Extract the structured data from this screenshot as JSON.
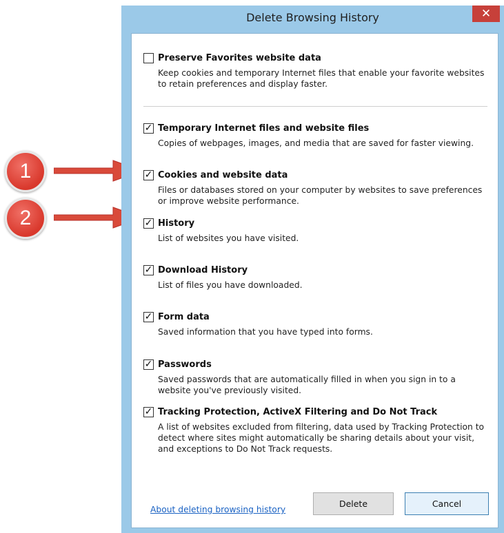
{
  "window": {
    "title": "Delete Browsing History",
    "close_glyph": "✕"
  },
  "items": [
    {
      "label": "Preserve Favorites website data",
      "checked": false,
      "description": "Keep cookies and temporary Internet files that enable your favorite websites to retain preferences and display faster."
    },
    {
      "label": "Temporary Internet files and website files",
      "checked": true,
      "description": "Copies of webpages, images, and media that are saved for faster viewing."
    },
    {
      "label": "Cookies and website data",
      "checked": true,
      "description": "Files or databases stored on your computer by websites to save preferences or improve website performance."
    },
    {
      "label": "History",
      "checked": true,
      "description": "List of websites you have visited."
    },
    {
      "label": "Download History",
      "checked": true,
      "description": "List of files you have downloaded."
    },
    {
      "label": "Form data",
      "checked": true,
      "description": "Saved information that you have typed into forms."
    },
    {
      "label": "Passwords",
      "checked": true,
      "description": "Saved passwords that are automatically filled in when you sign in to a website you've previously visited."
    },
    {
      "label": "Tracking Protection, ActiveX Filtering and Do Not Track",
      "checked": true,
      "description": "A list of websites excluded from filtering, data used by Tracking Protection to detect where sites might automatically be sharing details about your visit, and exceptions to Do Not Track requests."
    }
  ],
  "footer": {
    "link_text": "About deleting browsing history",
    "delete_label": "Delete",
    "cancel_label": "Cancel"
  },
  "annotations": [
    {
      "number": "1"
    },
    {
      "number": "2"
    }
  ],
  "colors": {
    "frame": "#9bc9e8",
    "close": "#c7403a",
    "badge": "#d9382c",
    "link": "#1a62c3"
  },
  "icons": {
    "checked": "✓"
  }
}
